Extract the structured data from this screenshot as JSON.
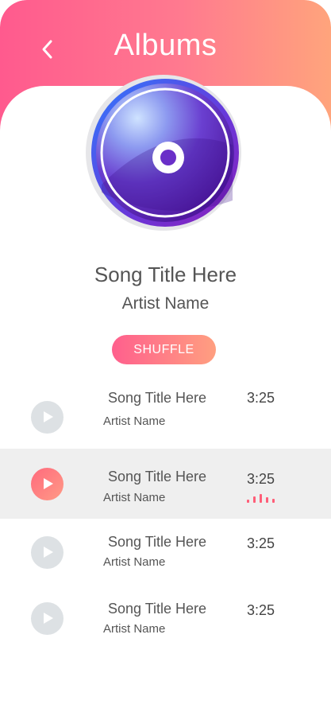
{
  "header": {
    "title": "Albums",
    "back_icon": "chevron-left-icon"
  },
  "now_playing": {
    "song_title": "Song Title Here",
    "artist": "Artist Name",
    "art_icon": "album-disc-icon"
  },
  "shuffle_label": "SHUFFLE",
  "tracks": [
    {
      "title": "Song Title Here",
      "artist": "Artist Name",
      "duration": "3:25",
      "playing": false
    },
    {
      "title": "Song Title Here",
      "artist": "Artist Name",
      "duration": "3:25",
      "playing": true
    },
    {
      "title": "Song Title Here",
      "artist": "Artist Name",
      "duration": "3:25",
      "playing": false
    },
    {
      "title": "Song Title Here",
      "artist": "Artist Name",
      "duration": "3:25",
      "playing": false
    }
  ],
  "colors": {
    "accent_start": "#ff5a8e",
    "accent_end": "#ffa47c",
    "active_row": "#efefef",
    "inactive_play": "#dde1e4"
  }
}
